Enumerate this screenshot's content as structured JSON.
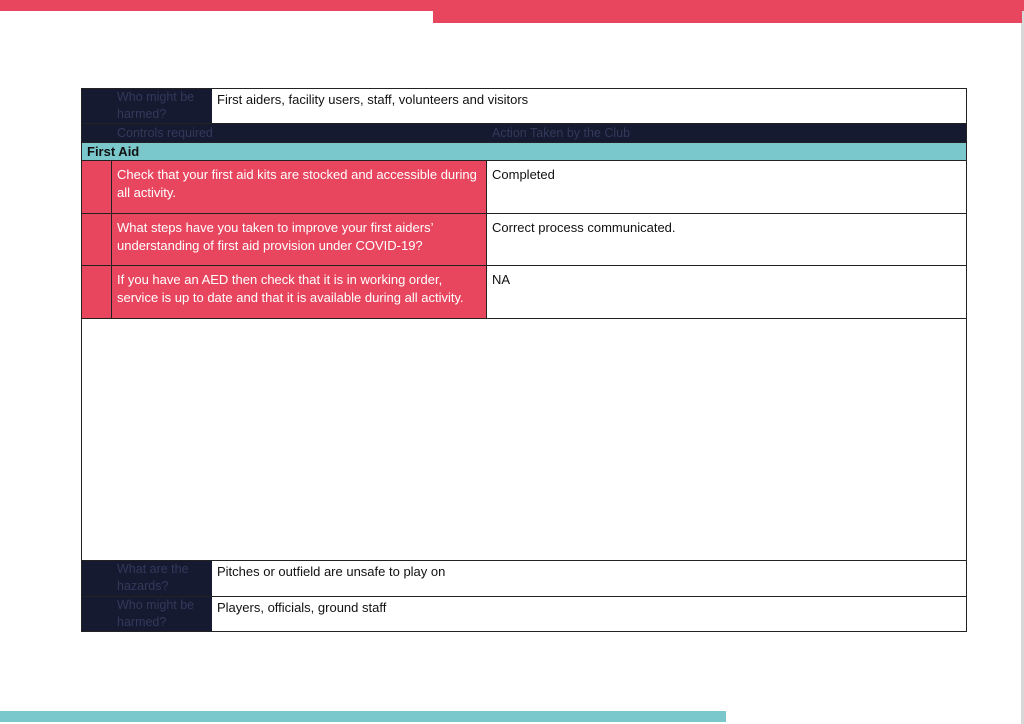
{
  "colors": {
    "navy": "#151a30",
    "pink": "#e8465f",
    "teal": "#7ac8cc"
  },
  "top_table": {
    "who_harmed_label": "Who might be harmed?",
    "who_harmed_value": "First aiders, facility users, staff, volunteers and visitors",
    "controls_header": "Controls required",
    "action_header": "Action Taken by the Club",
    "section_title": "First Aid",
    "rows": [
      {
        "control": "Check that your first aid kits are stocked and accessible during all activity.",
        "action": "Completed"
      },
      {
        "control": "What steps have you taken to improve your first aiders’ understanding of first aid provision under COVID-19?",
        "action": "Correct process communicated."
      },
      {
        "control": "If you have an AED then check that it is in working order, service is up to date and that it is available during all activity.",
        "action": "NA"
      }
    ]
  },
  "bottom_table": {
    "hazards_label": "What are the hazards?",
    "hazards_value": "Pitches or outfield are unsafe to play on",
    "who_harmed_label": "Who might be harmed?",
    "who_harmed_value": "Players, officials, ground staff"
  }
}
